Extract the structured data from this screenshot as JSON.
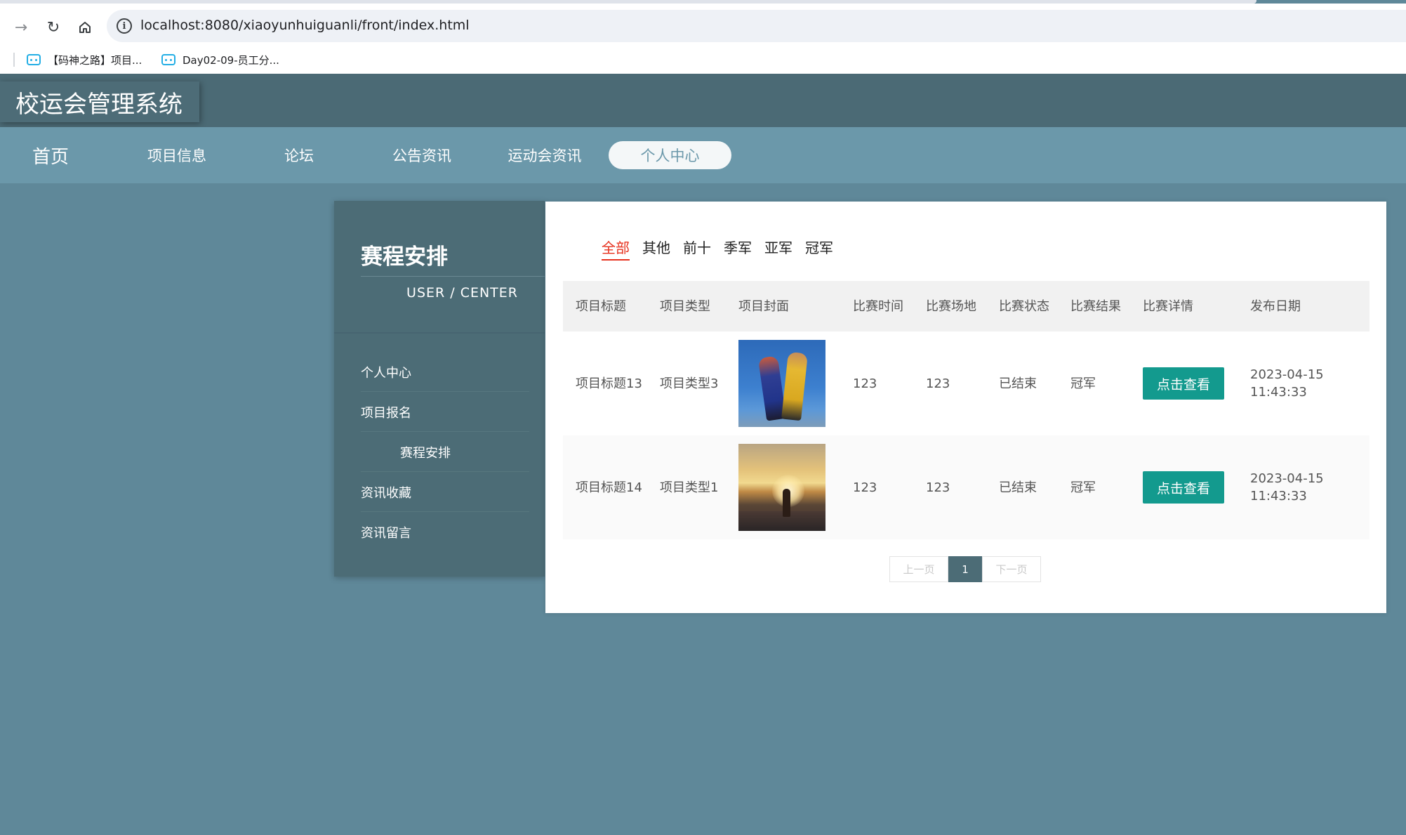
{
  "browser": {
    "url": "localhost:8080/xiaoyunhuiguanli/front/index.html",
    "bookmarks": [
      {
        "label": "【码神之路】项目..."
      },
      {
        "label": "Day02-09-员工分..."
      }
    ]
  },
  "site": {
    "logo": "校运会管理系统"
  },
  "nav": {
    "items": [
      {
        "label": "首页"
      },
      {
        "label": "项目信息"
      },
      {
        "label": "论坛"
      },
      {
        "label": "公告资讯"
      },
      {
        "label": "运动会资讯"
      },
      {
        "label": "个人中心"
      }
    ],
    "active_index": 5
  },
  "sidebar": {
    "title": "赛程安排",
    "subtitle": "USER / CENTER",
    "items": [
      {
        "label": "个人中心"
      },
      {
        "label": "项目报名"
      },
      {
        "label": "赛程安排"
      },
      {
        "label": "资讯收藏"
      },
      {
        "label": "资讯留言"
      }
    ],
    "active_index": 2
  },
  "filters": {
    "tabs": [
      {
        "label": "全部"
      },
      {
        "label": "其他"
      },
      {
        "label": "前十"
      },
      {
        "label": "季军"
      },
      {
        "label": "亚军"
      },
      {
        "label": "冠军"
      }
    ],
    "active_index": 0
  },
  "table": {
    "headers": [
      "项目标题",
      "项目类型",
      "项目封面",
      "比赛时间",
      "比赛场地",
      "比赛状态",
      "比赛结果",
      "比赛详情",
      "发布日期"
    ],
    "rows": [
      {
        "title": "项目标题13",
        "type": "项目类型3",
        "cover": "basketball-photo",
        "time": "123",
        "venue": "123",
        "status": "已结束",
        "result": "冠军",
        "action": "点击查看",
        "date": "2023-04-15",
        "clock": "11:43:33"
      },
      {
        "title": "项目标题14",
        "type": "项目类型1",
        "cover": "runner-sunset-photo",
        "time": "123",
        "venue": "123",
        "status": "已结束",
        "result": "冠军",
        "action": "点击查看",
        "date": "2023-04-15",
        "clock": "11:43:33"
      }
    ]
  },
  "pagination": {
    "prev": "上一页",
    "current": "1",
    "next": "下一页"
  },
  "colors": {
    "header": "#4b6a75",
    "nav": "#6b98aa",
    "sidebar": "#4c6c76",
    "button": "#139a8e",
    "active_filter": "#e7311e"
  }
}
